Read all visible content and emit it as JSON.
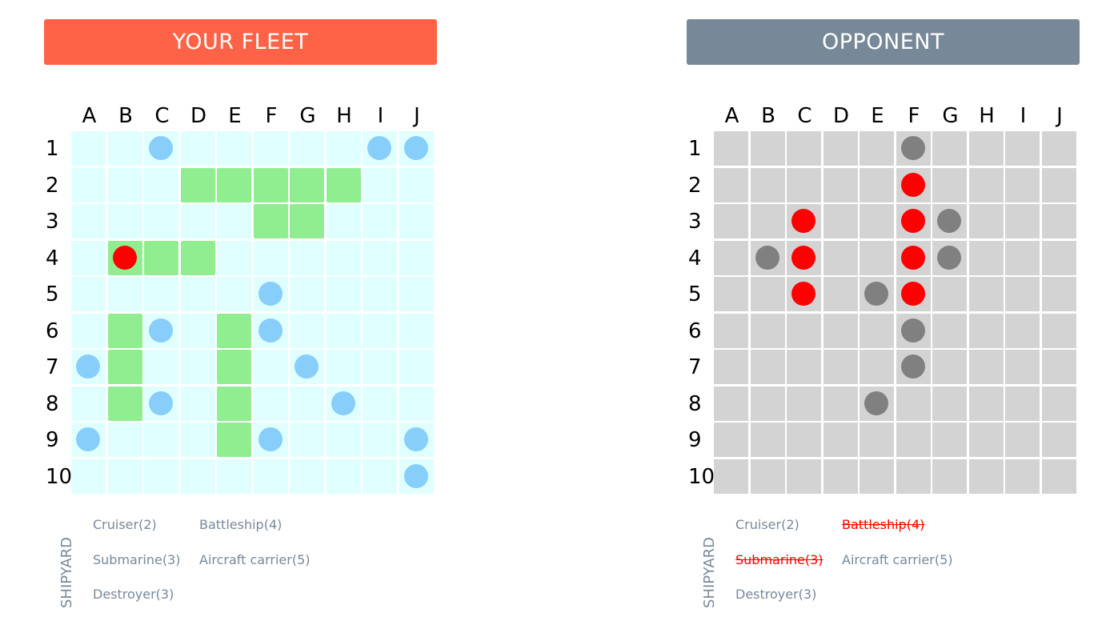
{
  "columns": [
    "A",
    "B",
    "C",
    "D",
    "E",
    "F",
    "G",
    "H",
    "I",
    "J"
  ],
  "rows": [
    "1",
    "2",
    "3",
    "4",
    "5",
    "6",
    "7",
    "8",
    "9",
    "10"
  ],
  "colors": {
    "your_header": "#ff6347",
    "opponent_header": "#778899",
    "water": "#e0ffff",
    "ship": "#90ee90",
    "unknown": "#d3d3d3",
    "miss_own": "#87cefa",
    "hit": "#ff0000",
    "miss_opponent": "#808080"
  },
  "your_fleet": {
    "title": "YOUR FLEET",
    "ship_cells": [
      "D2",
      "E2",
      "F2",
      "G2",
      "H2",
      "F3",
      "G3",
      "B4",
      "C4",
      "D4",
      "B6",
      "B7",
      "B8",
      "E6",
      "E7",
      "E8",
      "E9"
    ],
    "misses": [
      "C1",
      "I1",
      "J1",
      "F5",
      "C6",
      "F6",
      "A7",
      "G7",
      "C8",
      "H8",
      "A9",
      "F9",
      "J9",
      "J10"
    ],
    "hits": [
      "B4"
    ],
    "shipyard_label": "SHIPYARD",
    "ships": [
      {
        "name": "Cruiser(2)",
        "sunk": false
      },
      {
        "name": "Battleship(4)",
        "sunk": false
      },
      {
        "name": "Submarine(3)",
        "sunk": false
      },
      {
        "name": "Aircraft carrier(5)",
        "sunk": false
      },
      {
        "name": "Destroyer(3)",
        "sunk": false
      }
    ]
  },
  "opponent": {
    "title": "OPPONENT",
    "hits": [
      "F2",
      "C3",
      "F3",
      "C4",
      "F4",
      "C5",
      "F5"
    ],
    "misses": [
      "F1",
      "G3",
      "B4",
      "G4",
      "E5",
      "F6",
      "F7",
      "E8"
    ],
    "shipyard_label": "SHIPYARD",
    "ships": [
      {
        "name": "Cruiser(2)",
        "sunk": false
      },
      {
        "name": "Battleship(4)",
        "sunk": true
      },
      {
        "name": "Submarine(3)",
        "sunk": true
      },
      {
        "name": "Aircraft carrier(5)",
        "sunk": false
      },
      {
        "name": "Destroyer(3)",
        "sunk": false
      }
    ]
  }
}
